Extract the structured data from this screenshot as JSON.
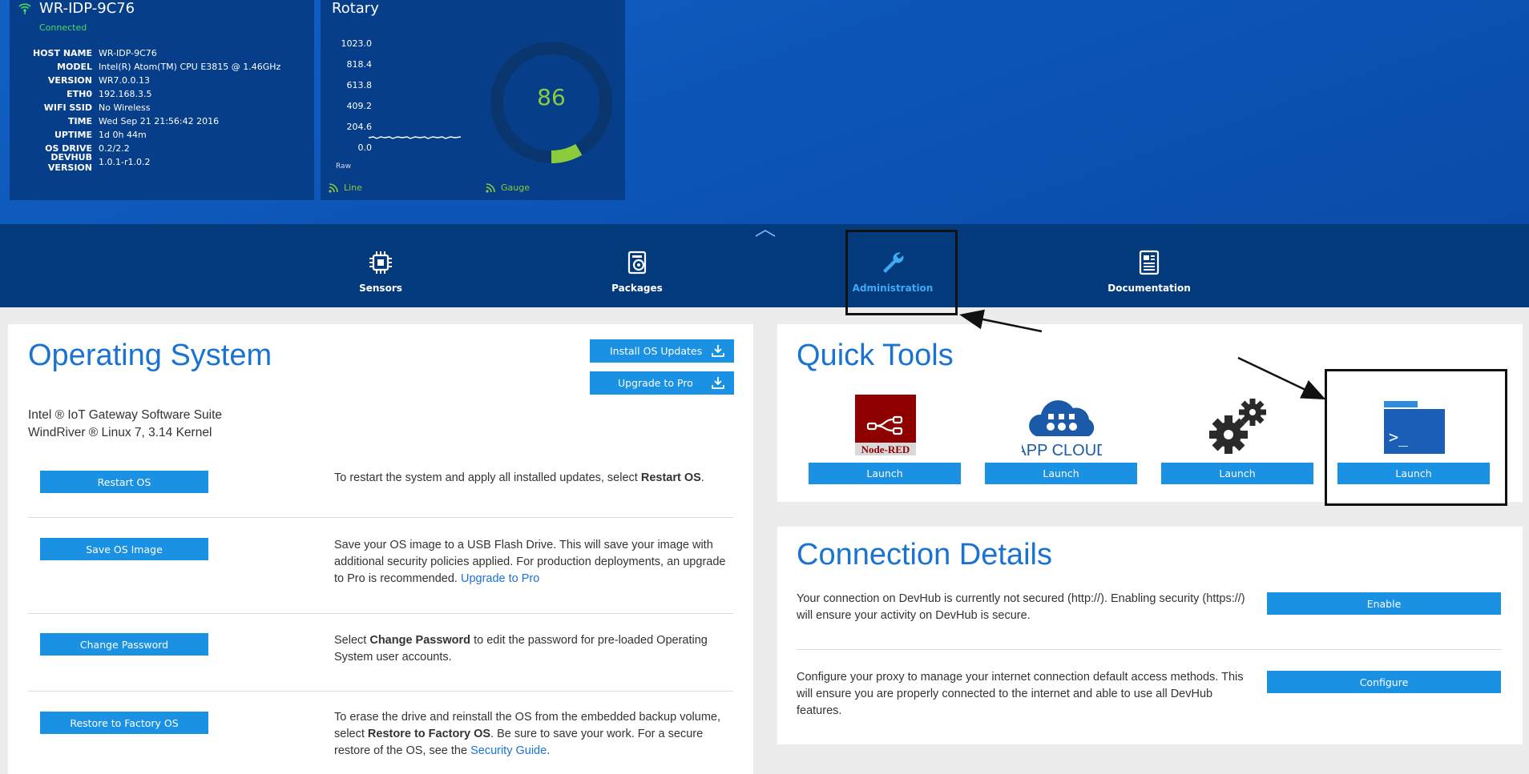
{
  "device": {
    "name": "WR-IDP-9C76",
    "status": "Connected",
    "info": [
      {
        "key": "HOST NAME",
        "value": "WR-IDP-9C76"
      },
      {
        "key": "MODEL",
        "value": "Intel(R) Atom(TM) CPU E3815 @ 1.46GHz"
      },
      {
        "key": "VERSION",
        "value": "WR7.0.0.13"
      },
      {
        "key": "ETH0",
        "value": "192.168.3.5"
      },
      {
        "key": "WIFI SSID",
        "value": "No Wireless"
      },
      {
        "key": "TIME",
        "value": "Wed Sep 21 21:56:42 2016"
      },
      {
        "key": "UPTIME",
        "value": "1d 0h 44m"
      },
      {
        "key": "OS DRIVE",
        "value": "0.2/2.2"
      },
      {
        "key": "DEVHUB VERSION",
        "value": "1.0.1-r1.0.2"
      }
    ]
  },
  "rotary": {
    "title": "Rotary",
    "y_ticks": [
      "1023.0",
      "818.4",
      "613.8",
      "409.2",
      "204.6",
      "0.0"
    ],
    "raw_label": "Raw",
    "gauge_value": "86",
    "gauge_max": 1023,
    "tabs": {
      "line": "Line",
      "gauge": "Gauge"
    }
  },
  "nav": {
    "items": [
      {
        "label": "Sensors",
        "icon": "chip-icon"
      },
      {
        "label": "Packages",
        "icon": "packages-icon"
      },
      {
        "label": "Administration",
        "icon": "wrench-icon"
      },
      {
        "label": "Documentation",
        "icon": "document-icon"
      }
    ],
    "active": "Administration"
  },
  "os": {
    "title": "Operating System",
    "install_updates": "Install OS Updates",
    "upgrade_pro": "Upgrade to Pro",
    "desc_line1": "Intel ® IoT Gateway Software Suite",
    "desc_line2": "WindRiver ® Linux 7, 3.14 Kernel",
    "rows": [
      {
        "button": "Restart OS",
        "pre": "To restart the system and apply all installed updates, select ",
        "bold": "Restart OS",
        "post": ".",
        "link": ""
      },
      {
        "button": "Save OS Image",
        "pre": "Save your OS image to a USB Flash Drive. This will save your image with additional security policies applied. For production deployments, an upgrade to Pro is recommended. ",
        "bold": "",
        "post": "",
        "link": "Upgrade to Pro"
      },
      {
        "button": "Change Password",
        "pre": "Select ",
        "bold": "Change Password",
        "post": " to edit the password for pre-loaded Operating System user accounts.",
        "link": ""
      },
      {
        "button": "Restore to Factory OS",
        "pre": "To erase the drive and reinstall the OS from the embedded backup volume, select ",
        "bold": "Restore to Factory OS",
        "post": ". Be sure to save your work. For a secure restore of the OS, see the ",
        "link": "Security Guide",
        "tail": "."
      }
    ]
  },
  "quick_tools": {
    "title": "Quick Tools",
    "tools": [
      {
        "name": "Node-RED",
        "button": "Launch"
      },
      {
        "name": "APP CLOUD",
        "button": "Launch"
      },
      {
        "name": "settings",
        "button": "Launch"
      },
      {
        "name": "terminal",
        "button": "Launch"
      }
    ]
  },
  "connection": {
    "title": "Connection Details",
    "security_text": "Your connection on DevHub is currently not secured (http://). Enabling security (https://) will ensure your activity on DevHub is secure.",
    "enable_button": "Enable",
    "proxy_text": "Configure your proxy to manage your internet connection default access methods. This will ensure you are properly connected to the internet and able to use all DevHub features.",
    "configure_button": "Configure"
  },
  "colors": {
    "accent": "#1a91e3",
    "title_blue": "#1b73d1",
    "nav_bg": "#033a7c",
    "status_green": "#4cd964",
    "gauge_green": "#8ccb3b"
  }
}
